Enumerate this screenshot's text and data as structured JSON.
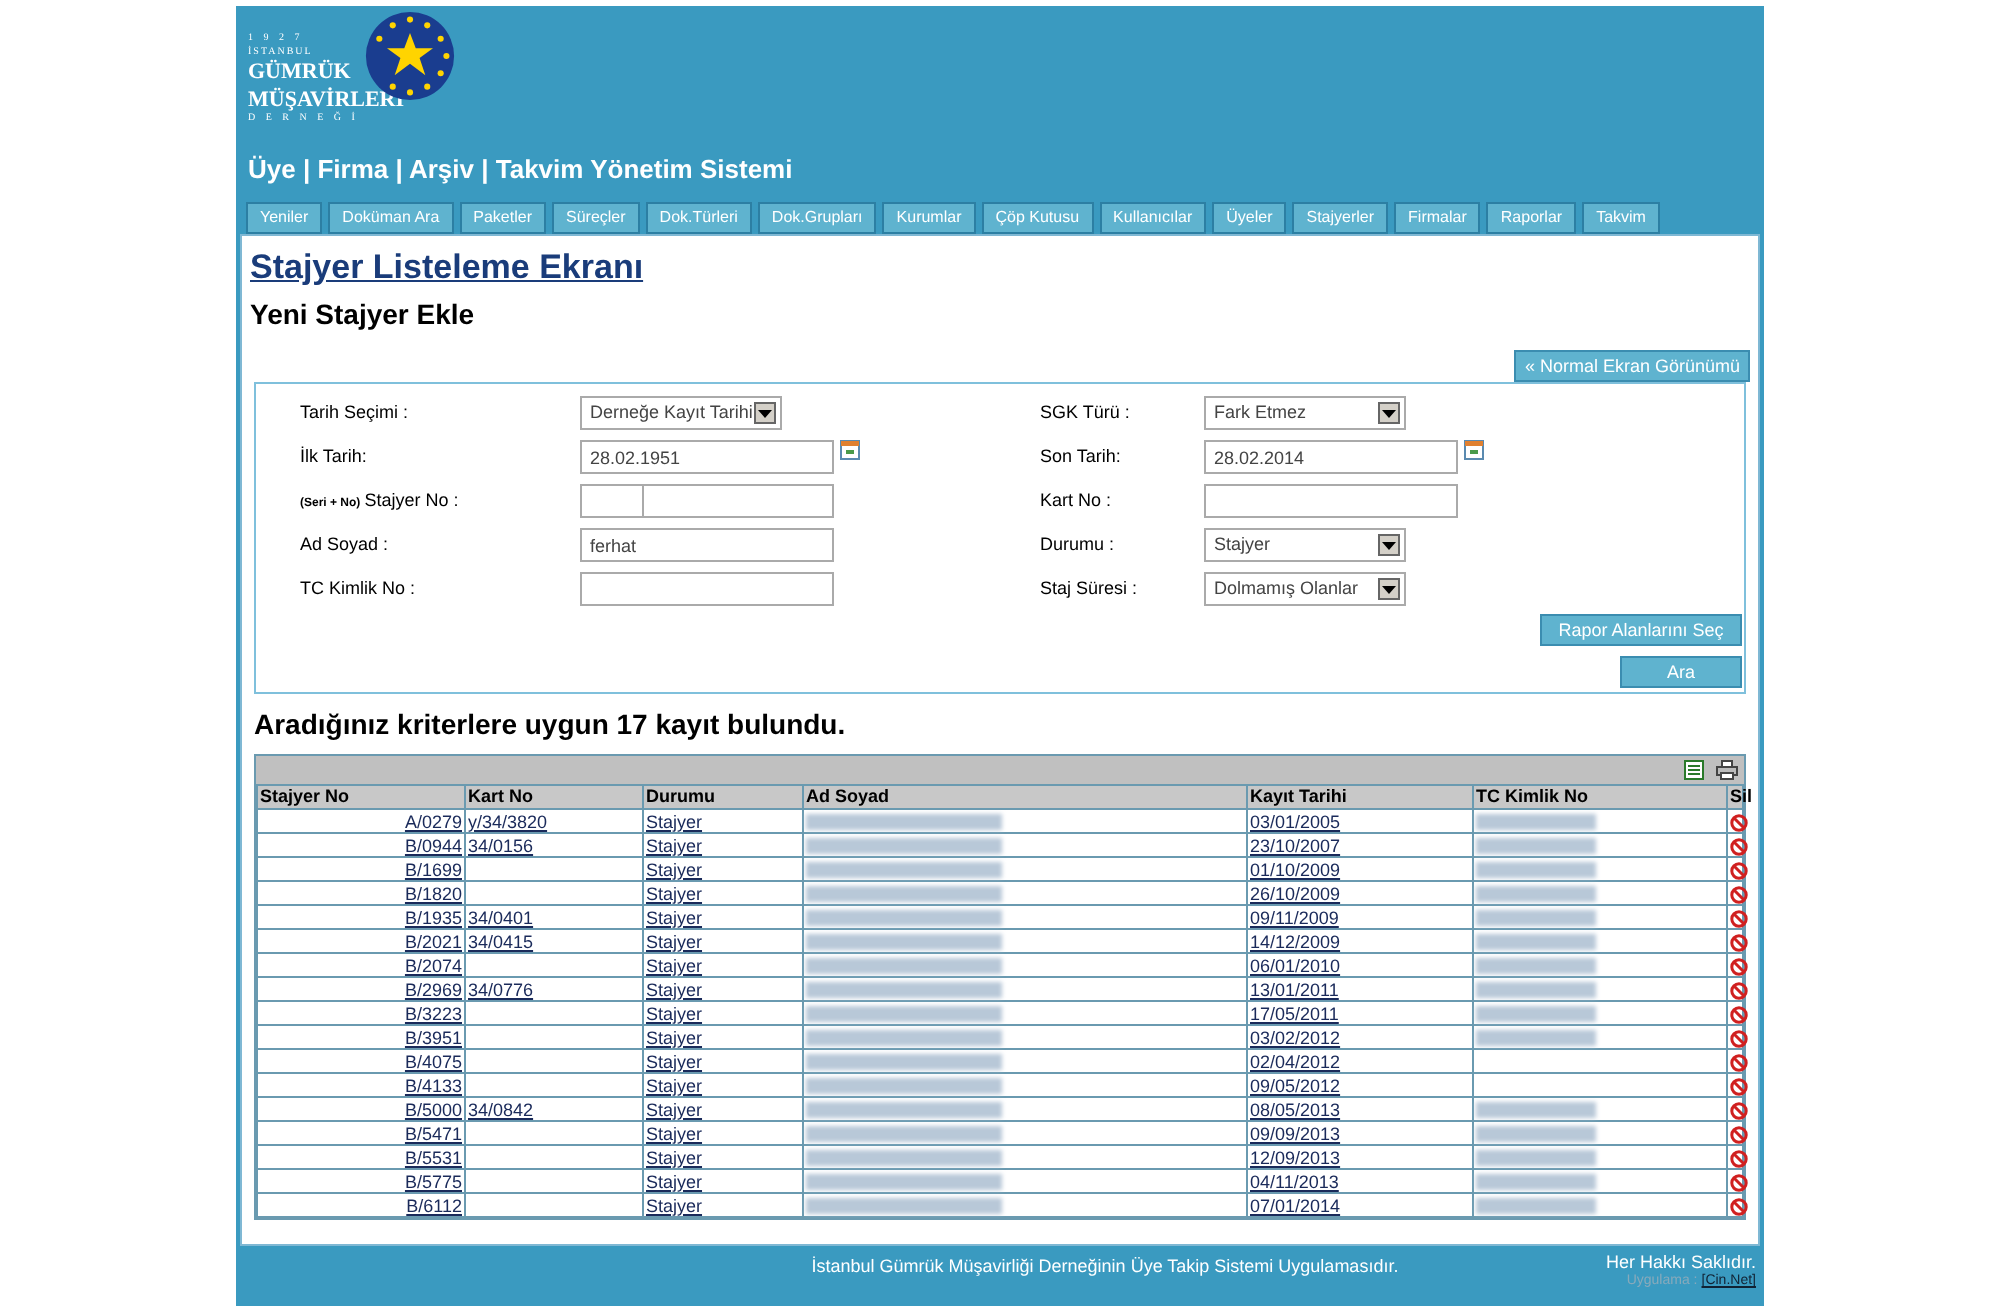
{
  "logo": {
    "year": "1 9 2 7",
    "city": "İSTANBUL",
    "line1": "GÜMRÜK",
    "line2": "MÜŞAVİRLERİ",
    "line3": "D E R N E Ğ İ"
  },
  "app_title": "Üye | Firma | Arşiv | Takvim Yönetim Sistemi",
  "tabs": [
    {
      "label": "Yeniler",
      "selected": false
    },
    {
      "label": "Doküman Ara",
      "selected": false
    },
    {
      "label": "Paketler",
      "selected": false
    },
    {
      "label": "Süreçler",
      "selected": false
    },
    {
      "label": "Dok.Türleri",
      "selected": false
    },
    {
      "label": "Dok.Grupları",
      "selected": false
    },
    {
      "label": "Kurumlar",
      "selected": false
    },
    {
      "label": "Çöp Kutusu",
      "selected": false
    },
    {
      "label": "Kullanıcılar",
      "selected": false
    },
    {
      "label": "Üyeler",
      "selected": false
    },
    {
      "label": "Stajyerler",
      "selected": false
    },
    {
      "label": "Firmalar",
      "selected": false
    },
    {
      "label": "Raporlar",
      "selected": false
    },
    {
      "label": "Takvim",
      "selected": false
    }
  ],
  "page_title": "Stajyer Listeleme Ekranı",
  "subtitle": "Yeni Stajyer Ekle",
  "normal_view_button": "« Normal Ekran Görünümü",
  "form_left": [
    {
      "kind": "select",
      "label": "Tarih Seçimi :",
      "value": "Derneğe Kayıt Tarihi"
    },
    {
      "kind": "date",
      "label": "İlk Tarih:",
      "value": "28.02.1951"
    },
    {
      "kind": "split",
      "label_prefix": "(Seri + No)",
      "label": "Stajyer No :"
    },
    {
      "kind": "text",
      "label": "Ad Soyad :",
      "value": "ferhat"
    },
    {
      "kind": "text",
      "label": "TC Kimlik No :"
    }
  ],
  "form_right": [
    {
      "kind": "select",
      "label": "SGK Türü :",
      "value": "Fark Etmez"
    },
    {
      "kind": "date",
      "label": "Son Tarih:",
      "value": "28.02.2014"
    },
    {
      "kind": "text",
      "label": "Kart No :"
    },
    {
      "kind": "select",
      "label": "Durumu :",
      "value": "Stajyer"
    },
    {
      "kind": "select",
      "label": "Staj Süresi :",
      "value": "Dolmamış Olanlar"
    }
  ],
  "report_fields_button": "Rapor Alanlarını Seç",
  "search_button": "Ara",
  "result_text": "Aradığınız kriterlere uygun 17 kayıt bulundu.",
  "table": {
    "columns": [
      "Stajyer No",
      "Kart No",
      "Durumu",
      "Ad Soyad",
      "Kayıt Tarihi",
      "TC Kimlik No",
      "Sil"
    ],
    "rows": [
      {
        "stajyer_no": "A/0279",
        "kart_no": "y/34/3820",
        "durumu": "Stajyer",
        "ad_soyad_blurred": true,
        "kayit_tarihi": "03/01/2005",
        "tc_blurred": true
      },
      {
        "stajyer_no": "B/0944",
        "kart_no": "34/0156",
        "durumu": "Stajyer",
        "ad_soyad_blurred": true,
        "kayit_tarihi": "23/10/2007",
        "tc_blurred": true
      },
      {
        "stajyer_no": "B/1699",
        "durumu": "Stajyer",
        "ad_soyad_blurred": true,
        "kayit_tarihi": "01/10/2009",
        "tc_blurred": true
      },
      {
        "stajyer_no": "B/1820",
        "durumu": "Stajyer",
        "ad_soyad_blurred": true,
        "kayit_tarihi": "26/10/2009",
        "tc_blurred": true
      },
      {
        "stajyer_no": "B/1935",
        "kart_no": "34/0401",
        "durumu": "Stajyer",
        "ad_soyad_blurred": true,
        "kayit_tarihi": "09/11/2009",
        "tc_blurred": true
      },
      {
        "stajyer_no": "B/2021",
        "kart_no": "34/0415",
        "durumu": "Stajyer",
        "ad_soyad_blurred": true,
        "kayit_tarihi": "14/12/2009",
        "tc_blurred": true
      },
      {
        "stajyer_no": "B/2074",
        "durumu": "Stajyer",
        "ad_soyad_blurred": true,
        "kayit_tarihi": "06/01/2010",
        "tc_blurred": true
      },
      {
        "stajyer_no": "B/2969",
        "kart_no": "34/0776",
        "durumu": "Stajyer",
        "ad_soyad_blurred": true,
        "kayit_tarihi": "13/01/2011",
        "tc_blurred": true
      },
      {
        "stajyer_no": "B/3223",
        "durumu": "Stajyer",
        "ad_soyad_blurred": true,
        "kayit_tarihi": "17/05/2011",
        "tc_blurred": true
      },
      {
        "stajyer_no": "B/3951",
        "durumu": "Stajyer",
        "ad_soyad_blurred": true,
        "kayit_tarihi": "03/02/2012",
        "tc_blurred": true
      },
      {
        "stajyer_no": "B/4075",
        "durumu": "Stajyer",
        "ad_soyad_blurred": true,
        "kayit_tarihi": "02/04/2012",
        "tc_blurred": false
      },
      {
        "stajyer_no": "B/4133",
        "durumu": "Stajyer",
        "ad_soyad_blurred": true,
        "kayit_tarihi": "09/05/2012",
        "tc_blurred": false
      },
      {
        "stajyer_no": "B/5000",
        "kart_no": "34/0842",
        "durumu": "Stajyer",
        "ad_soyad_blurred": true,
        "kayit_tarihi": "08/05/2013",
        "tc_blurred": true
      },
      {
        "stajyer_no": "B/5471",
        "durumu": "Stajyer",
        "ad_soyad_blurred": true,
        "kayit_tarihi": "09/09/2013",
        "tc_blurred": true
      },
      {
        "stajyer_no": "B/5531",
        "durumu": "Stajyer",
        "ad_soyad_blurred": true,
        "kayit_tarihi": "12/09/2013",
        "tc_blurred": true
      },
      {
        "stajyer_no": "B/5775",
        "durumu": "Stajyer",
        "ad_soyad_blurred": true,
        "kayit_tarihi": "04/11/2013",
        "tc_blurred": true
      },
      {
        "stajyer_no": "B/6112",
        "durumu": "Stajyer",
        "ad_soyad_blurred": true,
        "kayit_tarihi": "07/01/2014",
        "tc_blurred": true
      }
    ]
  },
  "footer": {
    "text": "İstanbul Gümrük Müşavirliği Derneğinin Üye Takip Sistemi Uygulamasıdır.",
    "rights": "Her Hakkı Saklıdır.",
    "credit_label": "Uygulama :",
    "credit_link": "[Cin.Net]"
  }
}
